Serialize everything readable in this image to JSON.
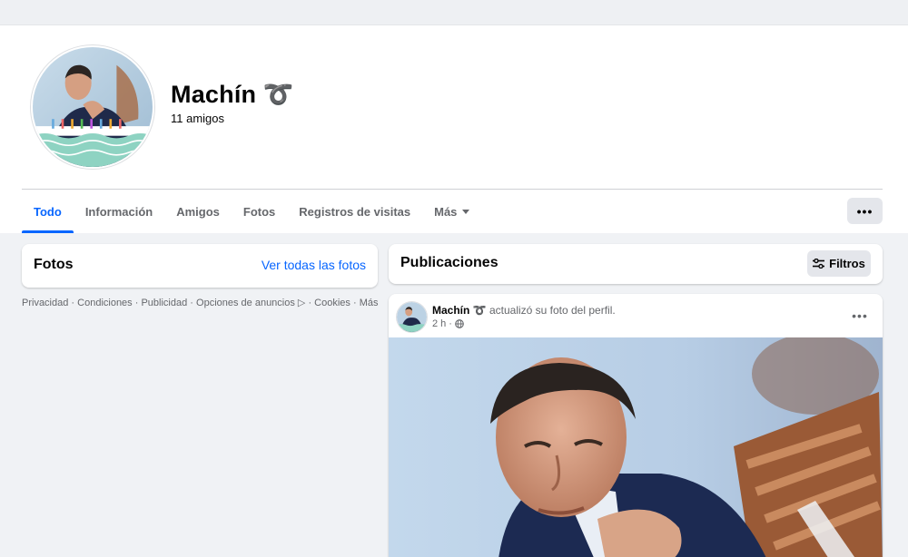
{
  "profile": {
    "name": "Machín ➰",
    "friends_count": "11 amigos"
  },
  "tabs": [
    {
      "label": "Todo",
      "active": true
    },
    {
      "label": "Información"
    },
    {
      "label": "Amigos"
    },
    {
      "label": "Fotos"
    },
    {
      "label": "Registros de visitas"
    },
    {
      "label": "Más"
    }
  ],
  "photos_section": {
    "title": "Fotos",
    "see_all": "Ver todas las fotos"
  },
  "footer": {
    "links": [
      "Privacidad",
      "Condiciones",
      "Publicidad",
      "Opciones de anuncios ▷",
      "Cookies",
      "Más"
    ],
    "separator": " · "
  },
  "posts_section": {
    "title": "Publicaciones",
    "filters_label": "Filtros"
  },
  "post": {
    "author": "Machín ➰",
    "action": " actualizó su foto del perfil.",
    "time": "2 h",
    "meta_sep": " · ",
    "audience_icon": "globe-icon"
  },
  "colors": {
    "accent": "#0866ff",
    "background": "#f0f2f5",
    "secondary_text": "#65676b"
  }
}
